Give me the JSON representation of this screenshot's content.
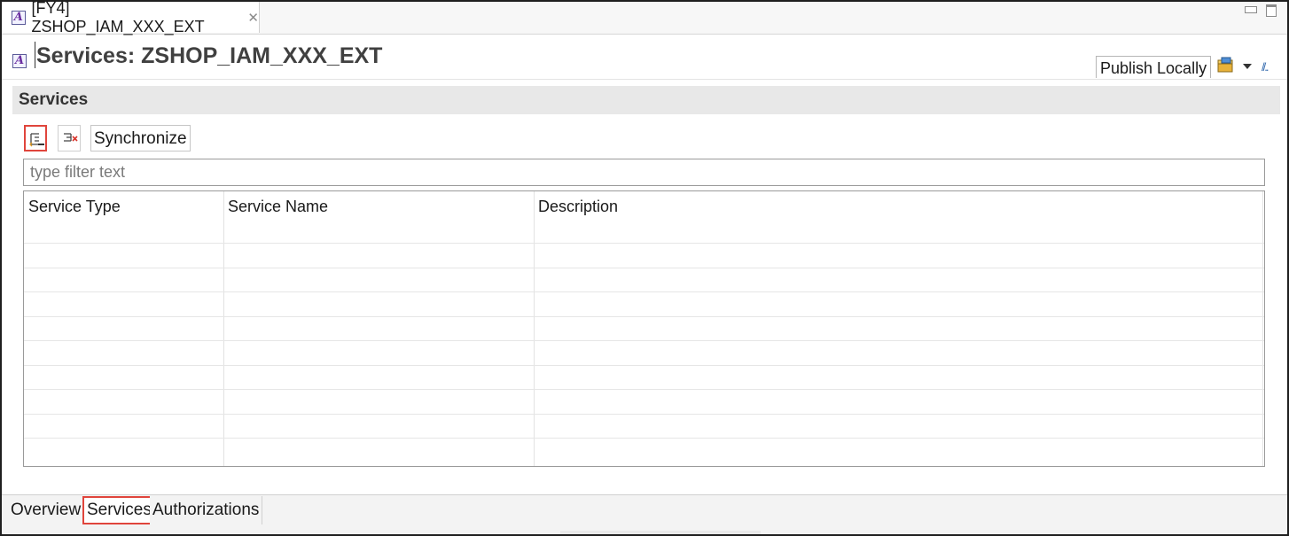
{
  "editor_tab": {
    "title": "[FY4] ZSHOP_IAM_XXX_EXT",
    "close_glyph": "✕"
  },
  "header": {
    "title": "Services: ZSHOP_IAM_XXX_EXT",
    "publish_label": "Publish Locally"
  },
  "section": {
    "title": "Services",
    "toolbar": {
      "synchronize_label": "Synchronize"
    },
    "filter": {
      "placeholder": "type filter text",
      "value": ""
    },
    "table": {
      "columns": [
        "Service Type",
        "Service Name",
        "Description"
      ],
      "rows": []
    }
  },
  "page_tabs": [
    {
      "label": "Overview",
      "active": false
    },
    {
      "label": "Services",
      "active": true
    },
    {
      "label": "Authorizations",
      "active": false
    }
  ],
  "icons": {
    "editor": "abap-object-icon",
    "add": "add-service-icon",
    "remove": "remove-service-icon",
    "package": "package-icon",
    "dropdown": "chevron-down-icon",
    "more": "more-icon"
  },
  "colors": {
    "highlight": "#e0453c",
    "section_bg": "#e8e8e8",
    "title_text": "#404040"
  }
}
